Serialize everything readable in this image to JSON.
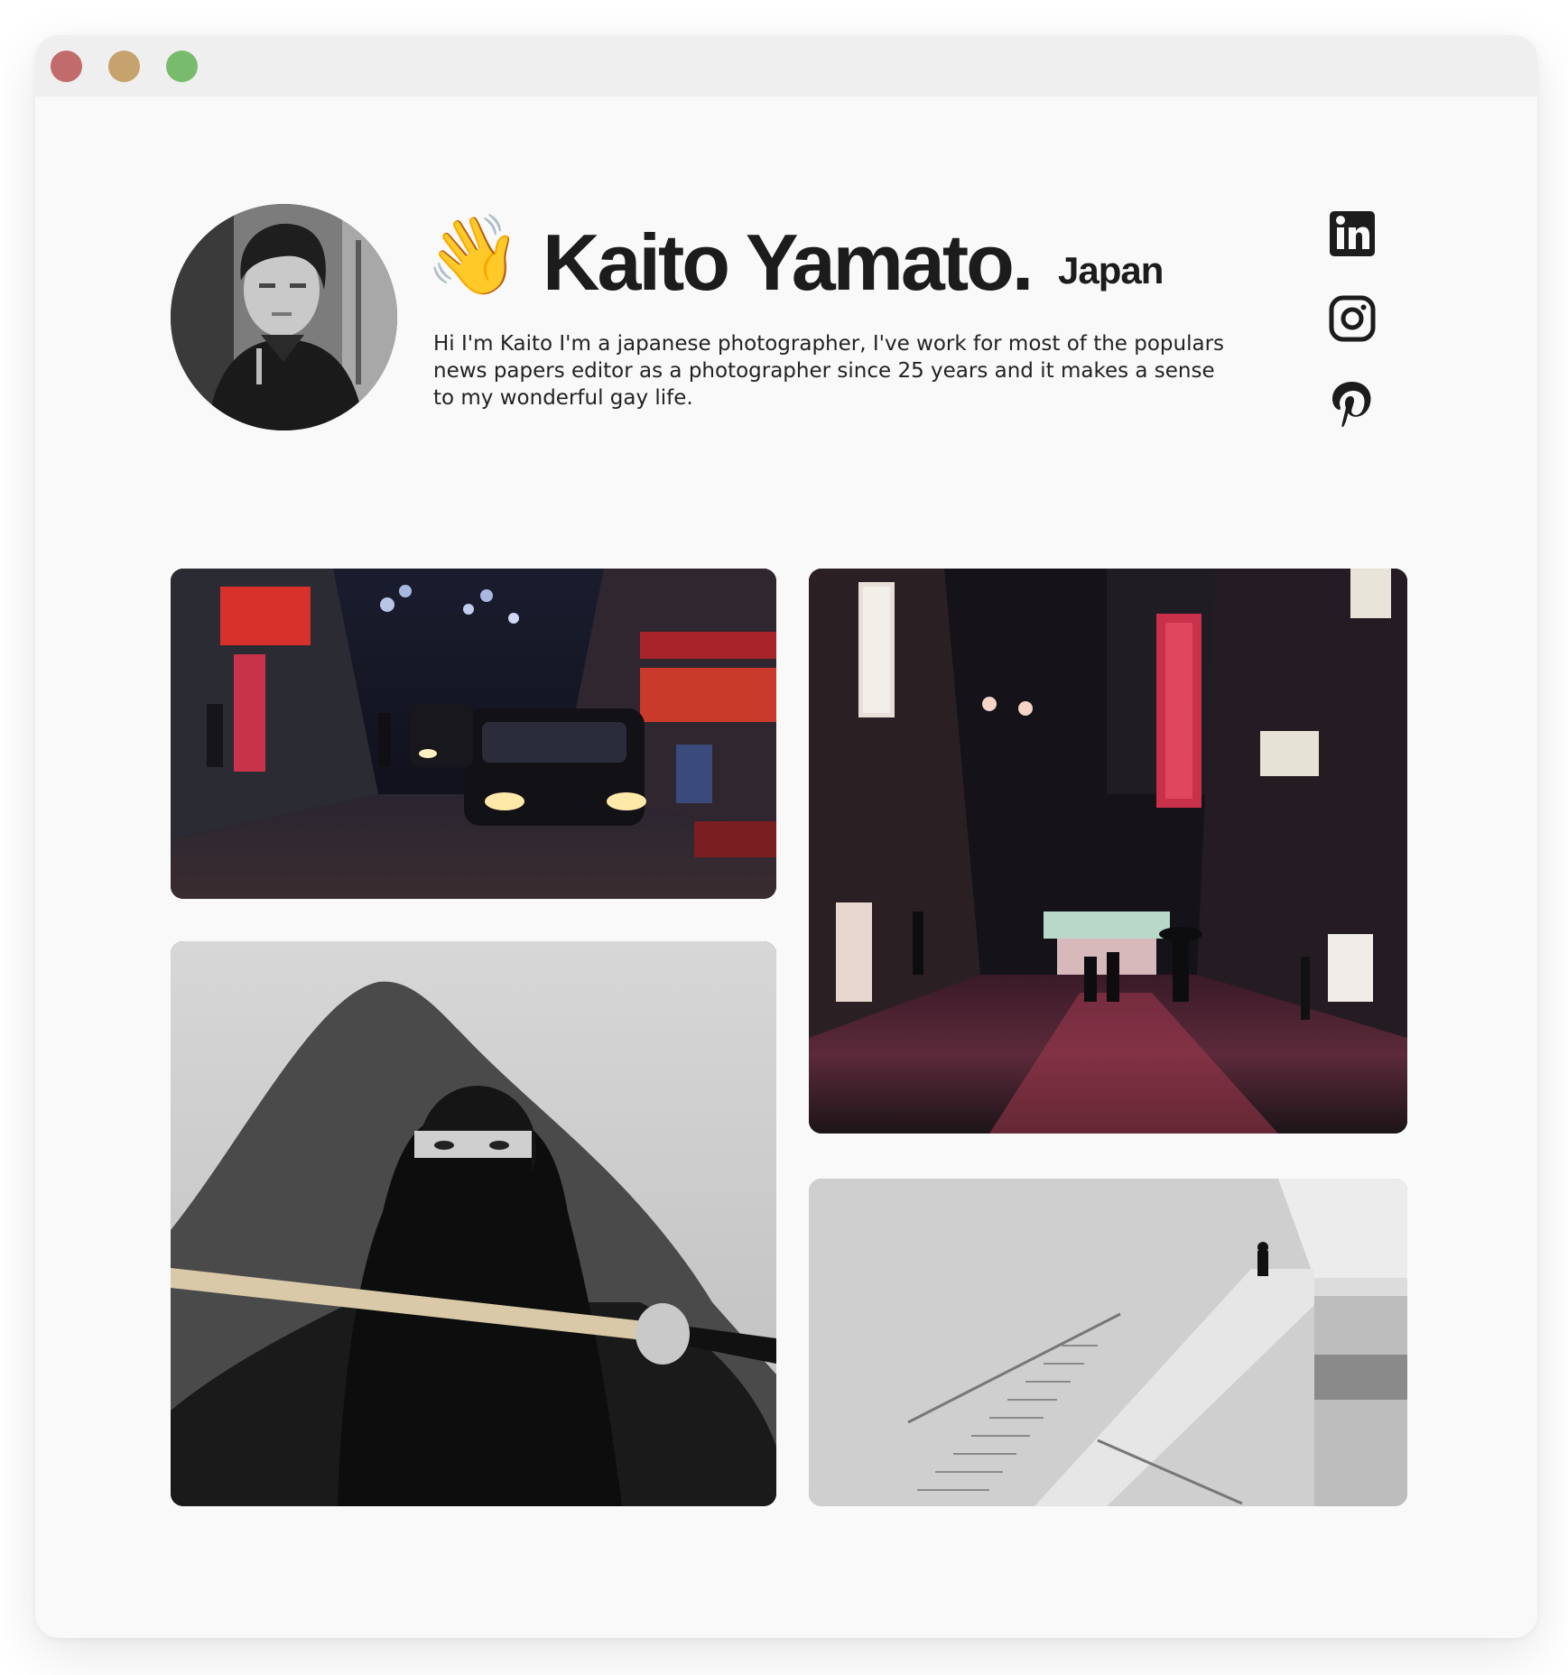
{
  "window": {
    "controls": [
      "close",
      "minimize",
      "maximize"
    ],
    "colors": {
      "close": "#c26b6d",
      "minimize": "#c6a26c",
      "maximize": "#79bb6d"
    }
  },
  "profile": {
    "wave_emoji": "👋",
    "name": "Kaito Yamato.",
    "country": "Japan",
    "bio": "Hi I'm Kaito I'm a japanese photographer, I've work for most of the populars news papers editor as a photographer since 25 years and it makes a sense to my wonderful gay life."
  },
  "social_links": [
    {
      "icon": "linkedin-icon"
    },
    {
      "icon": "instagram-icon"
    },
    {
      "icon": "pinterest-icon"
    }
  ],
  "gallery": [
    {
      "subject": "night street with taxis",
      "tone": "color"
    },
    {
      "subject": "neon-lit alley at night",
      "tone": "color"
    },
    {
      "subject": "ninja with sword in front of mountain",
      "tone": "black-and-white"
    },
    {
      "subject": "person on concrete staircase",
      "tone": "black-and-white"
    }
  ]
}
